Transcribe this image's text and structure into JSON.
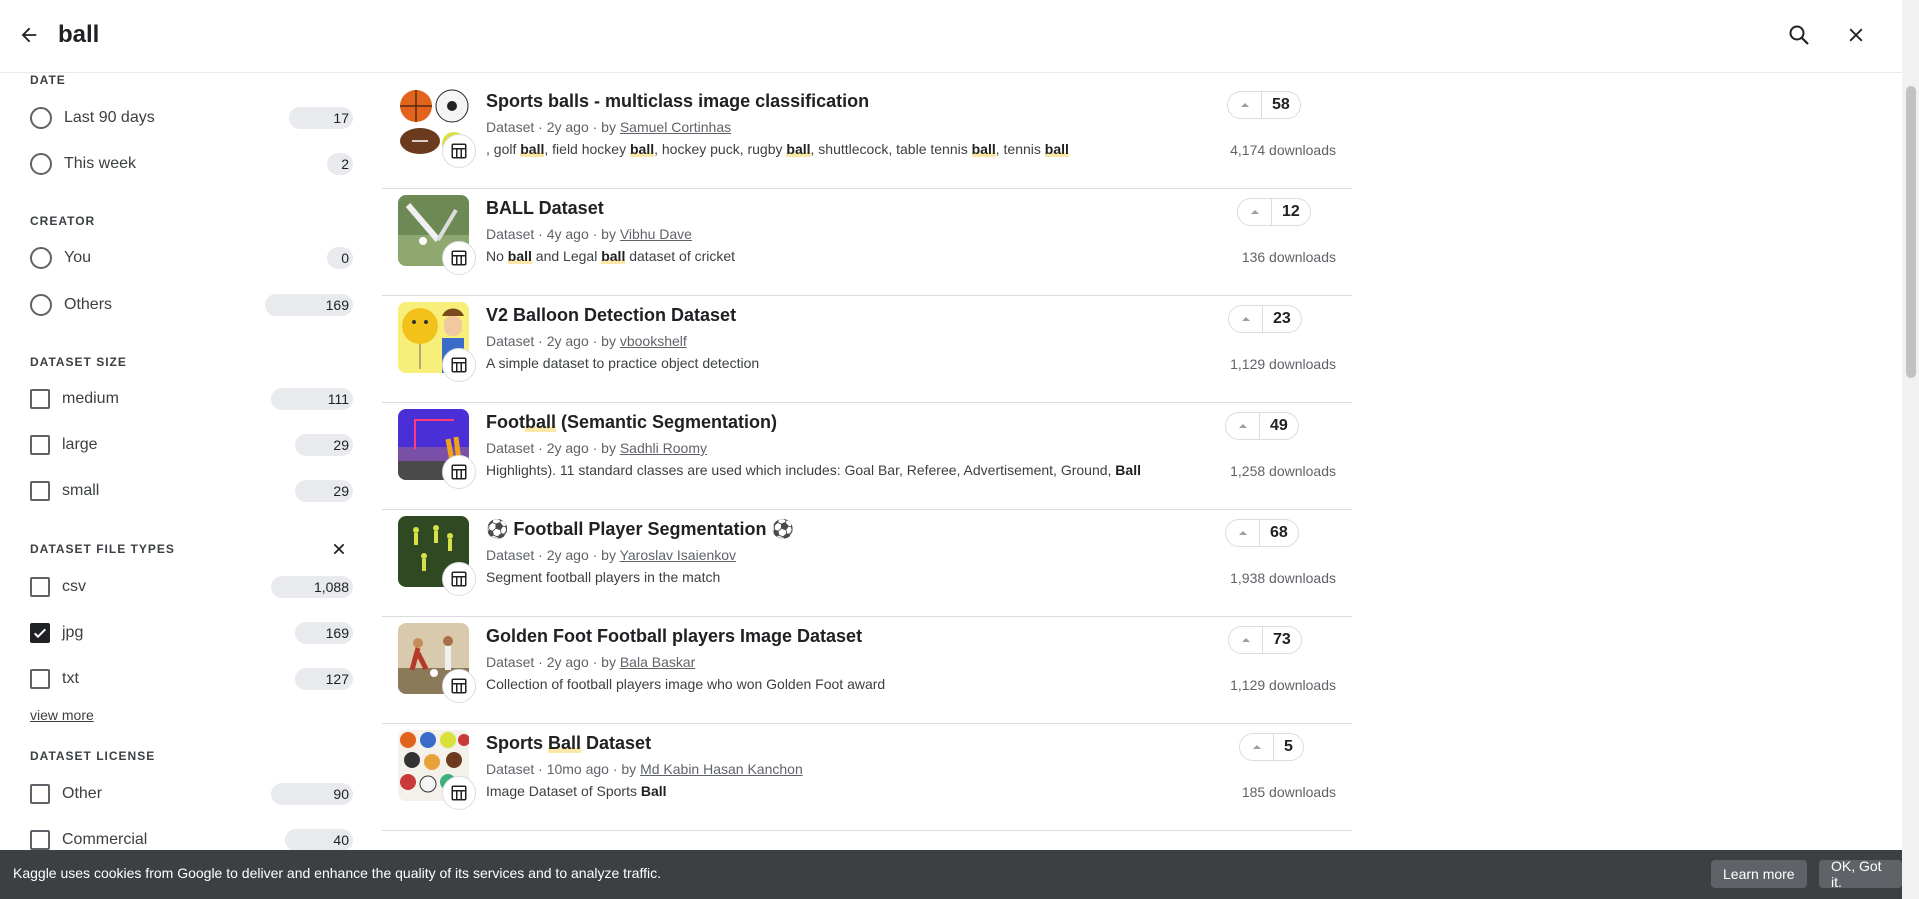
{
  "search": {
    "query": "ball"
  },
  "sidebar": {
    "date": {
      "title": "DATE",
      "options": [
        {
          "label": "Last 90 days",
          "count": "17"
        },
        {
          "label": "This week",
          "count": "2"
        }
      ]
    },
    "creator": {
      "title": "CREATOR",
      "options": [
        {
          "label": "You",
          "count": "0"
        },
        {
          "label": "Others",
          "count": "169"
        }
      ]
    },
    "dataset_size": {
      "title": "DATASET SIZE",
      "options": [
        {
          "label": "medium",
          "count": "111"
        },
        {
          "label": "large",
          "count": "29"
        },
        {
          "label": "small",
          "count": "29"
        }
      ]
    },
    "file_types": {
      "title": "DATASET FILE TYPES",
      "options": [
        {
          "label": "csv",
          "count": "1,088",
          "checked": false
        },
        {
          "label": "jpg",
          "count": "169",
          "checked": true
        },
        {
          "label": "txt",
          "count": "127",
          "checked": false
        }
      ],
      "view_more": "view more"
    },
    "license": {
      "title": "DATASET LICENSE",
      "options": [
        {
          "label": "Other",
          "count": "90"
        },
        {
          "label": "Commercial",
          "count": "40"
        }
      ]
    }
  },
  "results": [
    {
      "title_parts": [
        {
          "t": "Sports balls - multiclass image classification",
          "h": false
        }
      ],
      "meta_prefix": "Dataset · 2y ago · by ",
      "author": "Samuel Cortinhas",
      "snippet_parts": [
        {
          "t": ", golf ",
          "h": false
        },
        {
          "t": "ball",
          "h": true
        },
        {
          "t": ", field hockey ",
          "h": false
        },
        {
          "t": "ball",
          "h": true
        },
        {
          "t": ", hockey puck, rugby ",
          "h": false
        },
        {
          "t": "ball",
          "h": true
        },
        {
          "t": ", shuttlecock, table tennis ",
          "h": false
        },
        {
          "t": "ball",
          "h": true
        },
        {
          "t": ", tennis ",
          "h": false
        },
        {
          "t": "ball",
          "h": true
        }
      ],
      "votes": "58",
      "downloads": "4,174 downloads"
    },
    {
      "title_parts": [
        {
          "t": "BALL Dataset",
          "h": false
        }
      ],
      "meta_prefix": "Dataset · 4y ago · by ",
      "author": "Vibhu Dave",
      "snippet_parts": [
        {
          "t": "No ",
          "h": false
        },
        {
          "t": "ball",
          "h": true
        },
        {
          "t": " and Legal ",
          "h": false
        },
        {
          "t": "ball",
          "h": true
        },
        {
          "t": " dataset of cricket",
          "h": false
        }
      ],
      "votes": "12",
      "downloads": "136 downloads"
    },
    {
      "title_parts": [
        {
          "t": "V2 Balloon Detection Dataset",
          "h": false
        }
      ],
      "meta_prefix": "Dataset · 2y ago · by ",
      "author": "vbookshelf",
      "snippet_parts": [
        {
          "t": "A simple dataset to practice object detection",
          "h": false
        }
      ],
      "votes": "23",
      "downloads": "1,129 downloads"
    },
    {
      "title_parts": [
        {
          "t": "Foot",
          "h": false
        },
        {
          "t": "ball",
          "h": true
        },
        {
          "t": " (Semantic Segmentation)",
          "h": false
        }
      ],
      "meta_prefix": "Dataset · 2y ago · by ",
      "author": "Sadhli Roomy",
      "snippet_parts": [
        {
          "t": "Highlights). 11 standard classes are used which includes: Goal Bar, Referee, Advertisement, Ground, ",
          "h": false
        },
        {
          "t": "Ball",
          "h": "bold"
        }
      ],
      "votes": "49",
      "downloads": "1,258 downloads"
    },
    {
      "title_parts": [
        {
          "t": "⚽ Football Player Segmentation ⚽",
          "h": false
        }
      ],
      "meta_prefix": "Dataset · 2y ago · by ",
      "author": "Yaroslav Isaienkov",
      "snippet_parts": [
        {
          "t": "Segment football players in the match",
          "h": false
        }
      ],
      "votes": "68",
      "downloads": "1,938 downloads"
    },
    {
      "title_parts": [
        {
          "t": "Golden Foot Football players Image Dataset",
          "h": false
        }
      ],
      "meta_prefix": "Dataset · 2y ago · by ",
      "author": "Bala Baskar",
      "snippet_parts": [
        {
          "t": "Collection of football players image who won Golden Foot award",
          "h": false
        }
      ],
      "votes": "73",
      "downloads": "1,129 downloads"
    },
    {
      "title_parts": [
        {
          "t": "Sports ",
          "h": false
        },
        {
          "t": "Ball",
          "h": true
        },
        {
          "t": " Dataset",
          "h": false
        }
      ],
      "meta_prefix": "Dataset · 10mo ago · by ",
      "author": "Md Kabin Hasan Kanchon",
      "snippet_parts": [
        {
          "t": "Image Dataset of Sports ",
          "h": false
        },
        {
          "t": "Ball",
          "h": "bold"
        }
      ],
      "votes": "5",
      "downloads": "185 downloads"
    }
  ],
  "cookie": {
    "text": "Kaggle uses cookies from Google to deliver and enhance the quality of its services and to analyze traffic.",
    "learn_more": "Learn more",
    "ok": "OK, Got it."
  },
  "icons": {
    "back": "arrow-back-icon",
    "search": "search-icon",
    "close": "close-icon",
    "dataset_badge": "table-icon",
    "upvote": "caret-up-icon",
    "check": "check-icon"
  },
  "colors": {
    "highlight": "#fce8a6",
    "pill": "#e8eaed",
    "cookie_bar": "#3c4043"
  }
}
